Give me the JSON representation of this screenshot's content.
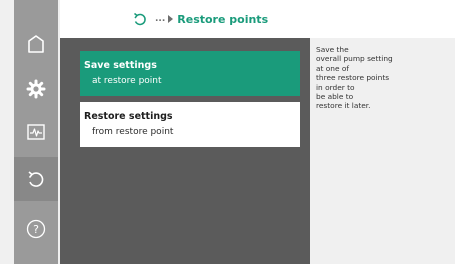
{
  "nav": {
    "items": [
      {
        "name": "home",
        "icon": "home-icon"
      },
      {
        "name": "settings",
        "icon": "gear-icon"
      },
      {
        "name": "diagnostics",
        "icon": "pulse-monitor-icon"
      },
      {
        "name": "restore",
        "icon": "restore-arrow-icon",
        "active": true
      },
      {
        "name": "help",
        "icon": "question-circle-icon"
      }
    ]
  },
  "header": {
    "icon": "restore-arrow-icon",
    "dots": "...",
    "title": "Restore points"
  },
  "menu": {
    "items": [
      {
        "title": "Save settings",
        "subtitle": "at restore point",
        "selected": true
      },
      {
        "title": "Restore settings",
        "subtitle": "from restore point",
        "selected": false
      }
    ]
  },
  "help": {
    "lines": [
      "Save the",
      "overall pump setting",
      "at one of",
      "three restore points",
      "in order to",
      "be able to",
      "restore it later."
    ]
  },
  "colors": {
    "accent": "#1a9b7b",
    "rail": "#9a9a9a",
    "rail_active": "#888888",
    "menu_bg": "#5b5b5b",
    "background": "#f0f0f0"
  }
}
